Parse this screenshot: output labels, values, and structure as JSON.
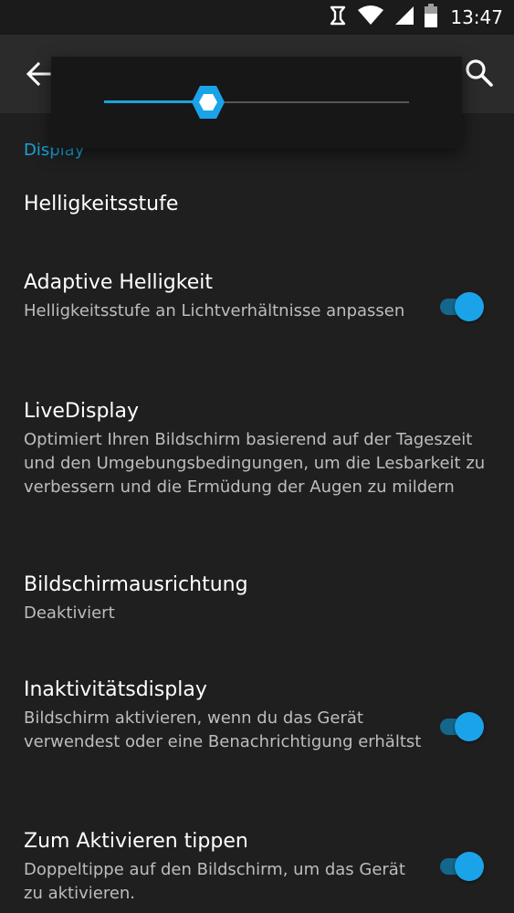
{
  "status_bar": {
    "time": "13:47",
    "icons": [
      "nfc-icon",
      "wifi-icon",
      "signal-icon",
      "battery-icon"
    ]
  },
  "action_bar": {
    "back_icon": "back-arrow-icon",
    "search_icon": "search-icon"
  },
  "brightness_dialog": {
    "level": 0.34,
    "accent_color": "#1aa3d9"
  },
  "section": {
    "header": "Display"
  },
  "prefs": [
    {
      "title": "Helligkeitsstufe"
    },
    {
      "title": "Adaptive Helligkeit",
      "summary": "Helligkeitsstufe an Lichtverhältnisse anpassen",
      "toggle": true
    },
    {
      "title": "LiveDisplay",
      "summary": "Optimiert Ihren Bildschirm basierend auf der Tageszeit und den Umgebungsbedingungen, um die Lesbarkeit zu verbessern und die Ermüdung der Augen zu mildern"
    },
    {
      "title": "Bildschirmausrichtung",
      "summary": "Deaktiviert"
    },
    {
      "title": "Inaktivitätsdisplay",
      "summary": "Bildschirm aktivieren, wenn du das Gerät verwendest oder eine Benachrichtigung erhältst",
      "toggle": true
    },
    {
      "title": "Zum Aktivieren tippen",
      "summary": "Doppeltippe auf den Bildschirm, um das Gerät zu aktivieren.",
      "toggle": true
    }
  ],
  "colors": {
    "background": "#1f1f1f",
    "accent": "#1aa3d9",
    "toggle_track": "#14668a"
  }
}
